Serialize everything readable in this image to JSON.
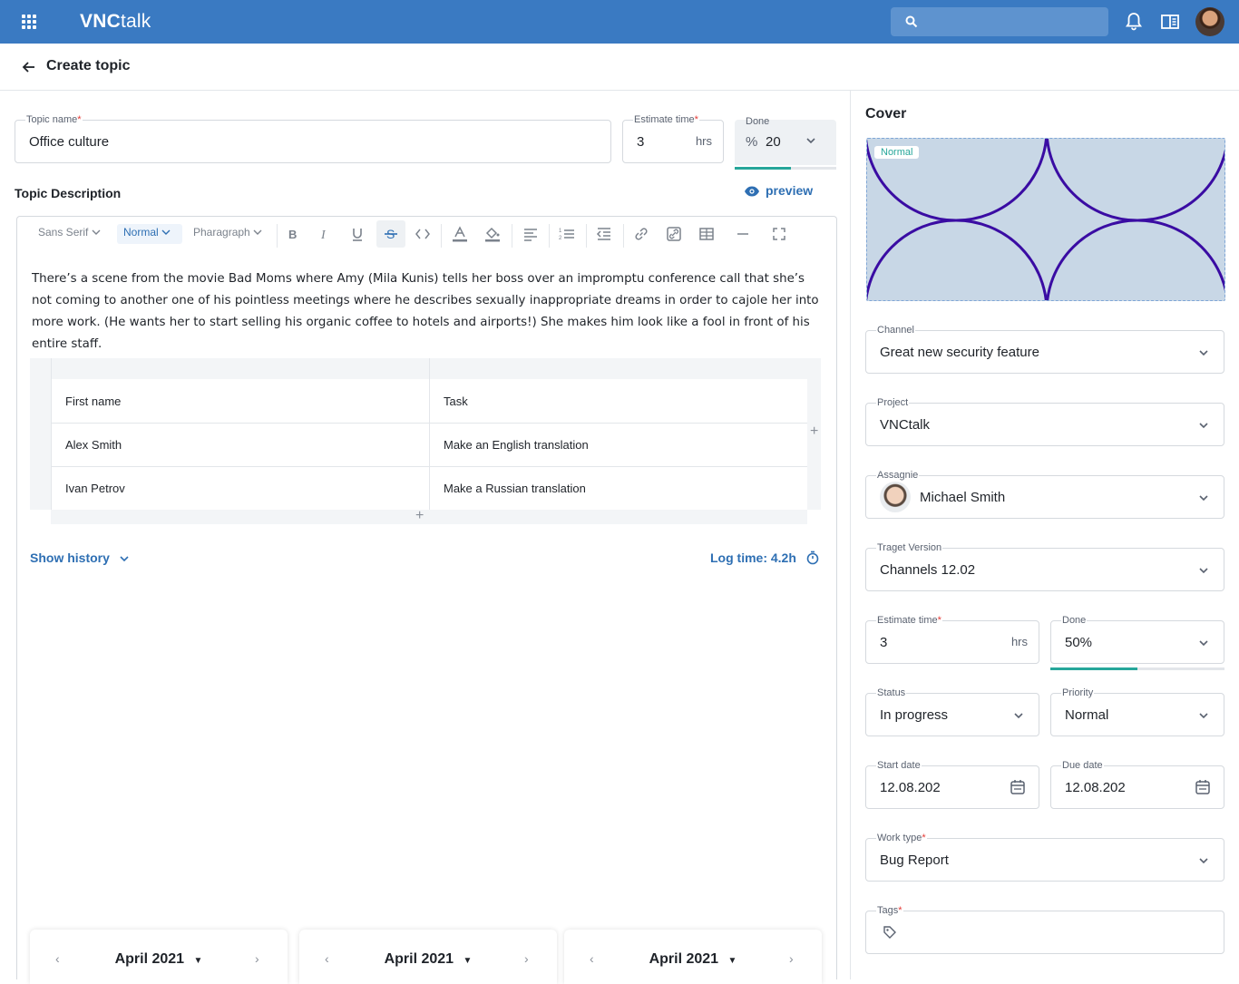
{
  "app": {
    "brand_bold": "VNC",
    "brand_light": "talk"
  },
  "header": {
    "title": "Create topic"
  },
  "form": {
    "topic_name": {
      "label": "Topic name",
      "required": "*",
      "value": "Office culture"
    },
    "estimate": {
      "label": "Estimate time",
      "required": "*",
      "value": "3",
      "unit": "hrs"
    },
    "done": {
      "label": "Done",
      "prefix": "%",
      "value": "20",
      "progress": 0.55
    },
    "description_label": "Topic Description",
    "preview_label": "preview"
  },
  "toolbar": {
    "font": "Sans Serif",
    "size": "Normal",
    "block": "Pharagraph"
  },
  "description": "There’s a scene from the movie Bad Moms where Amy (Mila Kunis) tells her boss over an impromptu conference call that she’s not coming to another one of his pointless meetings where he describes sexually inappropriate dreams in order to cajole her into more work. (He wants her to start selling his organic coffee to hotels and airports!) She makes him look like a fool in front of his entire staff.",
  "table": {
    "rows": [
      [
        "First name",
        "Task"
      ],
      [
        "Alex Smith",
        "Make an English translation"
      ],
      [
        "Ivan Petrov",
        "Make a Russian translation"
      ]
    ]
  },
  "history": {
    "show_label": "Show history",
    "log_time": "Log time: 4.2h"
  },
  "calendars": [
    {
      "month": "April 2021"
    },
    {
      "month": "April 2021"
    },
    {
      "month": "April 2021"
    }
  ],
  "sidebar": {
    "cover_title": "Cover",
    "cover_badge": "Normal",
    "channel": {
      "label": "Channel",
      "value": "Great new security feature"
    },
    "project": {
      "label": "Project",
      "value": "VNCtalk"
    },
    "assignee": {
      "label": "Assagnie",
      "value": "Michael Smith"
    },
    "target_version": {
      "label": "Traget Version",
      "value": "Channels 12.02"
    },
    "estimate": {
      "label": "Estimate time",
      "required": "*",
      "value": "3",
      "unit": "hrs"
    },
    "done": {
      "label": "Done",
      "value": "50%",
      "progress": 0.5
    },
    "status": {
      "label": "Status",
      "value": "In progress"
    },
    "priority": {
      "label": "Priority",
      "value": "Normal"
    },
    "start_date": {
      "label": "Start date",
      "value": "12.08.202"
    },
    "due_date": {
      "label": "Due date",
      "value": "12.08.202"
    },
    "work_type": {
      "label": "Work type",
      "required": "*",
      "value": "Bug Report"
    },
    "tags": {
      "label": "Tags",
      "required": "*"
    }
  },
  "colors": {
    "header": "#3a7ac2",
    "accent": "#2e6fb3",
    "progress": "#26a69a",
    "required": "#e53935"
  }
}
